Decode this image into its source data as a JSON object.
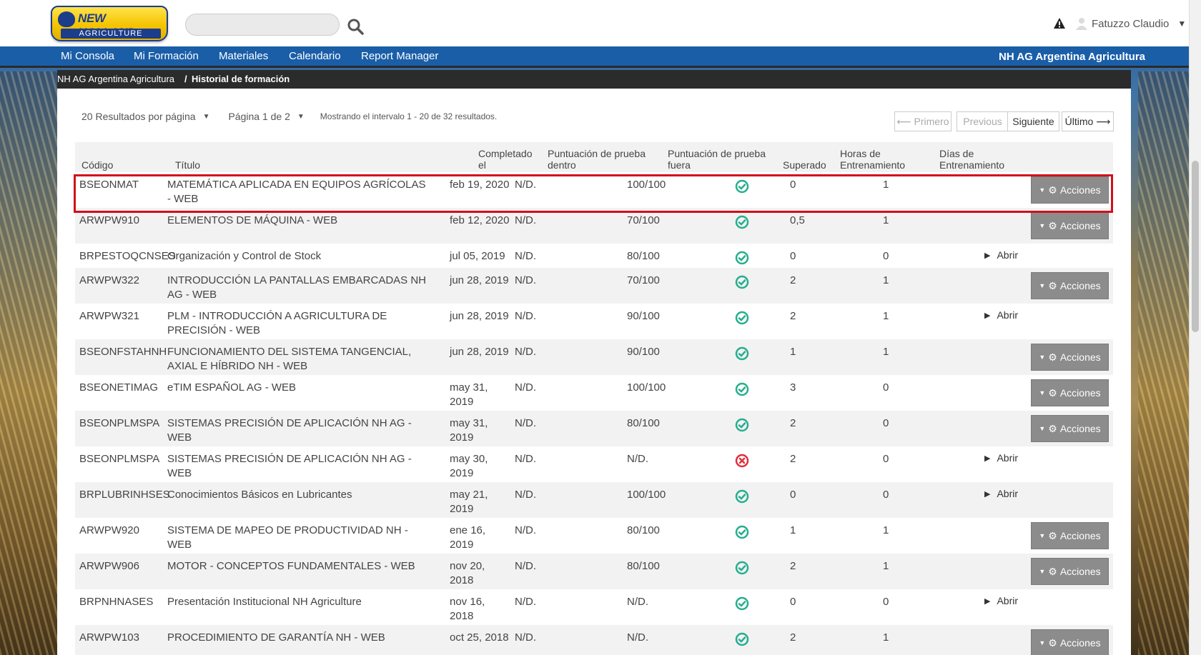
{
  "header": {
    "logo_brand": "NEW HOLLAND",
    "logo_sub": "AGRICULTURE",
    "search_placeholder": "",
    "user_name": "Fatuzzo Claudio"
  },
  "nav": {
    "items": [
      "Mi Consola",
      "Mi Formación",
      "Materiales",
      "Calendario",
      "Report Manager"
    ],
    "org": "NH AG Argentina Agricultura"
  },
  "breadcrumb": {
    "parent": "NH AG Argentina Agricultura",
    "separator": "/",
    "current": "Historial de formación"
  },
  "pager": {
    "per_page": "20 Resultados por página",
    "page": "Página 1 de 2",
    "info": "Mostrando el intervalo 1 - 20 de 32 resultados.",
    "first": "⟵ Primero",
    "previous": "Previous",
    "next": "Siguiente",
    "last": "Último ⟶"
  },
  "table": {
    "headers": {
      "codigo": "Código",
      "titulo": "Título",
      "completado": "Completado el",
      "pre": "Puntuación de prueba dentro",
      "post": "Puntuación de prueba fuera",
      "superado": "Superado",
      "horas": "Horas de Entrenamiento",
      "dias": "Días de Entrenamiento"
    },
    "action_label": "Acciones",
    "open_label": "Abrir",
    "rows": [
      {
        "code": "BSEONMAT",
        "title": "MATEMÁTICA APLICADA EN EQUIPOS AGRÍCOLAS - WEB",
        "date": "feb 19, 2020",
        "pre": "N/D.",
        "post": "100/100",
        "passed": true,
        "hours": "0",
        "days": "1",
        "action": "acciones"
      },
      {
        "code": "ARWPW910",
        "title": "ELEMENTOS DE MÁQUINA - WEB",
        "date": "feb 12, 2020",
        "pre": "N/D.",
        "post": "70/100",
        "passed": true,
        "hours": "0,5",
        "days": "1",
        "action": "acciones"
      },
      {
        "code": "BRPESTOQCNSES",
        "title": "Organización y Control de Stock",
        "date": "jul 05, 2019",
        "pre": "N/D.",
        "post": "80/100",
        "passed": true,
        "hours": "0",
        "days": "0",
        "action": "abrir"
      },
      {
        "code": "ARWPW322",
        "title": "INTRODUCCIÓN LA PANTALLAS EMBARCADAS NH AG - WEB",
        "date": "jun 28, 2019",
        "pre": "N/D.",
        "post": "70/100",
        "passed": true,
        "hours": "2",
        "days": "1",
        "action": "acciones"
      },
      {
        "code": "ARWPW321",
        "title": "PLM - INTRODUCCIÓN A AGRICULTURA DE PRECISIÓN - WEB",
        "date": "jun 28, 2019",
        "pre": "N/D.",
        "post": "90/100",
        "passed": true,
        "hours": "2",
        "days": "1",
        "action": "abrir"
      },
      {
        "code": "BSEONFSTAHNH",
        "title": "FUNCIONAMIENTO DEL SISTEMA TANGENCIAL, AXIAL E HÍBRIDO NH - WEB",
        "date": "jun 28, 2019",
        "pre": "N/D.",
        "post": "90/100",
        "passed": true,
        "hours": "1",
        "days": "1",
        "action": "acciones"
      },
      {
        "code": "BSEONETIMAG",
        "title": "eTIM ESPAÑOL AG - WEB",
        "date": "may 31, 2019",
        "pre": "N/D.",
        "post": "100/100",
        "passed": true,
        "hours": "3",
        "days": "0",
        "action": "acciones"
      },
      {
        "code": "BSEONPLMSPA",
        "title": "SISTEMAS PRECISIÓN DE APLICACIÓN NH AG - WEB",
        "date": "may 31, 2019",
        "pre": "N/D.",
        "post": "80/100",
        "passed": true,
        "hours": "2",
        "days": "0",
        "action": "acciones"
      },
      {
        "code": "BSEONPLMSPA",
        "title": "SISTEMAS PRECISIÓN DE APLICACIÓN NH AG - WEB",
        "date": "may 30, 2019",
        "pre": "N/D.",
        "post": "N/D.",
        "passed": false,
        "hours": "2",
        "days": "0",
        "action": "abrir"
      },
      {
        "code": "BRPLUBRINHSES",
        "title": "Conocimientos Básicos en Lubricantes",
        "date": "may 21, 2019",
        "pre": "N/D.",
        "post": "100/100",
        "passed": true,
        "hours": "0",
        "days": "0",
        "action": "abrir"
      },
      {
        "code": "ARWPW920",
        "title": "SISTEMA DE MAPEO DE PRODUCTIVIDAD NH - WEB",
        "date": "ene 16, 2019",
        "pre": "N/D.",
        "post": "80/100",
        "passed": true,
        "hours": "1",
        "days": "1",
        "action": "acciones"
      },
      {
        "code": "ARWPW906",
        "title": "MOTOR - CONCEPTOS FUNDAMENTALES - WEB",
        "date": "nov 20, 2018",
        "pre": "N/D.",
        "post": "80/100",
        "passed": true,
        "hours": "2",
        "days": "1",
        "action": "acciones"
      },
      {
        "code": "BRPNHNASES",
        "title": "Presentación Institucional NH Agriculture",
        "date": "nov 16, 2018",
        "pre": "N/D.",
        "post": "N/D.",
        "passed": true,
        "hours": "0",
        "days": "0",
        "action": "abrir"
      },
      {
        "code": "ARWPW103",
        "title": "PROCEDIMIENTO DE GARANTÍA NH - WEB",
        "date": "oct 25, 2018",
        "pre": "N/D.",
        "post": "N/D.",
        "passed": true,
        "hours": "2",
        "days": "1",
        "action": "acciones"
      }
    ]
  },
  "colors": {
    "nav_blue": "#1a5ea8",
    "pass_green": "#27ae8f",
    "fail_red": "#e0303a",
    "highlight_red": "#d0101a",
    "button_gray": "#8c8c8c"
  }
}
